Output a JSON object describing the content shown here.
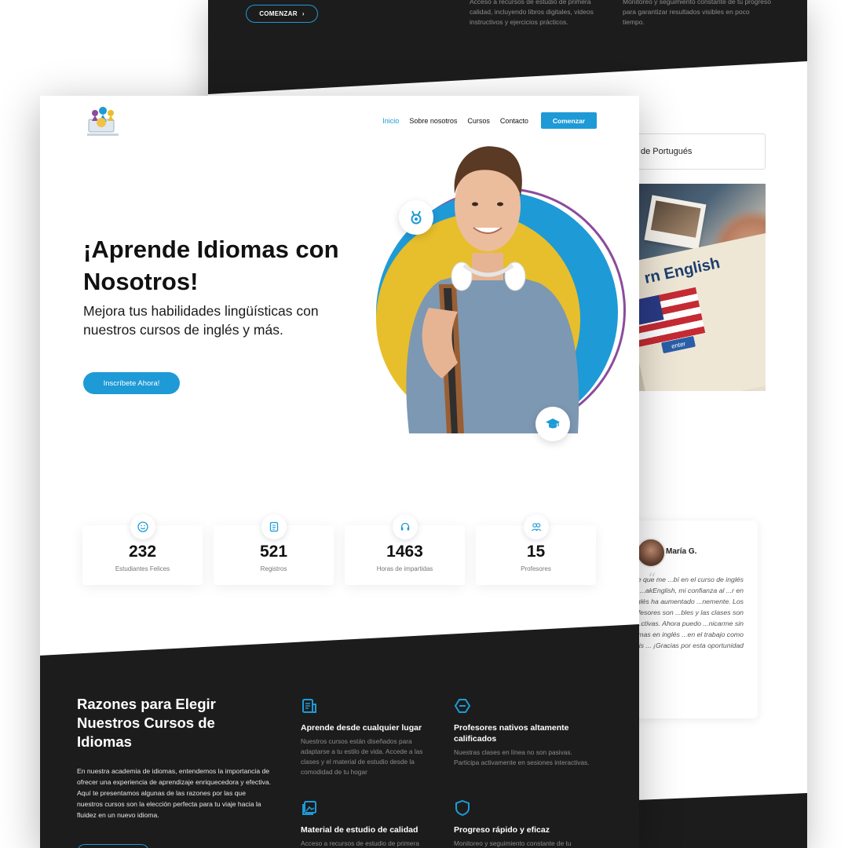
{
  "back": {
    "cta_label": "COMENZAR",
    "feature_a_text": "Acceso a recursos de estudio de primera calidad, incluyendo libros digitales, videos instructivos y ejercicios prácticos.",
    "feature_b_text": "Monitoreo y seguimiento constante de tu progreso para garantizar resultados visibles en poco tiempo.",
    "course_card_label": "de Portugués",
    "photo": {
      "book_title": "rn English",
      "enter_label": "enter"
    },
    "testimonial": {
      "name": "María G.",
      "text": "Desde que me ...bí en el curso de inglés de ...akEnglish, mi confianza al ...r en inglés ha aumentado ...nemente. Los profesores son ...bles y las clases son muy ...ctivas. Ahora puedo ...nicarme sin problemas en inglés ...en el trabajo como en mis ... ¡Gracias por esta oportunidad"
    }
  },
  "front": {
    "nav": [
      {
        "label": "Inicio",
        "active": true
      },
      {
        "label": "Sobre nosotros",
        "active": false
      },
      {
        "label": "Cursos",
        "active": false
      },
      {
        "label": "Contacto",
        "active": false
      }
    ],
    "nav_cta": "Comenzar",
    "hero": {
      "title": "¡Aprende Idiomas con Nosotros!",
      "subtitle": "Mejora tus habilidades lingüísticas con nuestros cursos de inglés y más.",
      "button": "Inscríbete Ahora!"
    },
    "stats": [
      {
        "value": "232",
        "label": "Estudiantes Felices",
        "icon": "smile-icon"
      },
      {
        "value": "521",
        "label": "Registros",
        "icon": "notebook-icon"
      },
      {
        "value": "1463",
        "label": "Horas de impartidas",
        "icon": "headset-icon"
      },
      {
        "value": "15",
        "label": "Profesores",
        "icon": "users-icon"
      }
    ],
    "reasons": {
      "title": "Razones para Elegir Nuestros Cursos de Idiomas",
      "body": "En nuestra academia de idiomas, entendemos la importancia de ofrecer una experiencia de aprendizaje enriquecedora y efectiva. Aquí te presentamos algunas de las razones por las que nuestros cursos son la elección perfecta para tu viaje hacia la fluidez en un nuevo idioma."
    },
    "features": [
      {
        "title": "Aprende desde cualquier lugar",
        "text": "Nuestros cursos están diseñados para adaptarse a tu estilo de vida. Accede a las clases y el material de estudio desde la comodidad de tu hogar",
        "icon": "book-icon"
      },
      {
        "title": "Profesores nativos altamente calificados",
        "text": "Nuestras clases en línea no son pasivas. Participa activamente en sesiones interactivas.",
        "icon": "hexagon-icon"
      },
      {
        "title": "Material de estudio de calidad",
        "text": "Acceso a recursos de estudio de primera",
        "icon": "image-icon"
      },
      {
        "title": "Progreso rápido y eficaz",
        "text": "Monitoreo y seguimiento constante de tu",
        "icon": "shield-icon"
      }
    ]
  },
  "colors": {
    "accent": "#1e9ad6",
    "dark": "#1c1c1c",
    "yellow": "#e7be2c",
    "purple": "#8a4c9c"
  }
}
